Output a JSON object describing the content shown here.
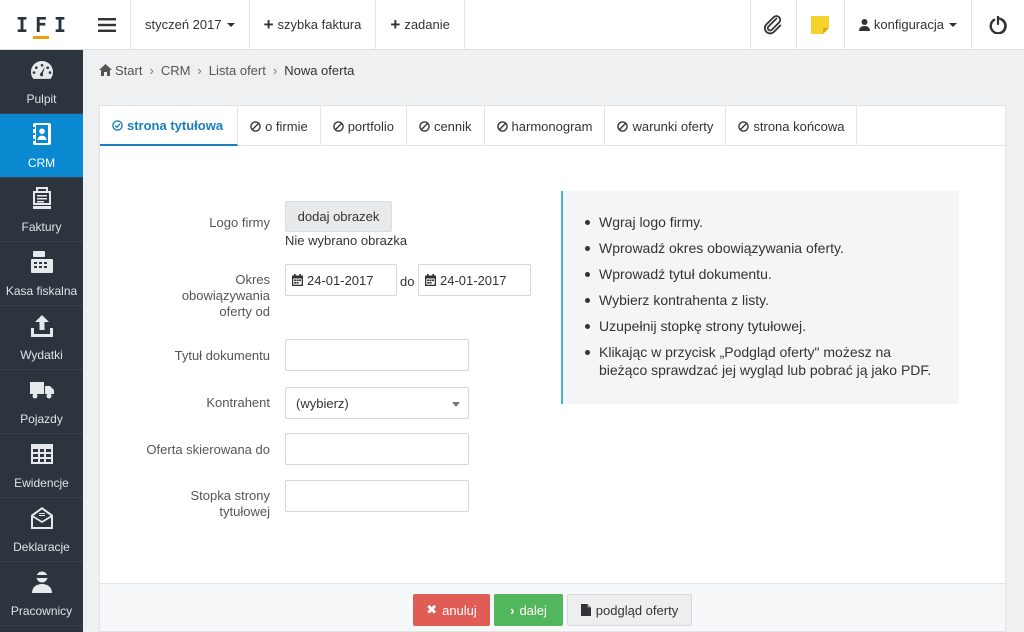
{
  "app": {
    "logo": "IFI"
  },
  "sidebar": {
    "items": [
      {
        "label": "Pulpit",
        "icon": "gauge-icon",
        "active": false
      },
      {
        "label": "CRM",
        "icon": "address-book-icon",
        "active": true
      },
      {
        "label": "Faktury",
        "icon": "invoice-icon",
        "active": false
      },
      {
        "label": "Kasa fiskalna",
        "icon": "cash-register-icon",
        "active": false
      },
      {
        "label": "Wydatki",
        "icon": "upload-icon",
        "active": false
      },
      {
        "label": "Pojazdy",
        "icon": "truck-icon",
        "active": false
      },
      {
        "label": "Ewidencje",
        "icon": "table-icon",
        "active": false
      },
      {
        "label": "Deklaracje",
        "icon": "envelope-icon",
        "active": false
      },
      {
        "label": "Pracownicy",
        "icon": "user-icon",
        "active": false
      }
    ]
  },
  "topbar": {
    "period": "styczeń 2017",
    "quick_invoice": "szybka faktura",
    "task": "zadanie",
    "config": "konfiguracja",
    "note_color": "#f7d42b"
  },
  "breadcrumb": {
    "items": [
      "Start",
      "CRM",
      "Lista ofert"
    ],
    "current": "Nowa oferta"
  },
  "tabs": [
    {
      "label": "strona tytułowa",
      "active": true
    },
    {
      "label": "o firmie",
      "active": false
    },
    {
      "label": "portfolio",
      "active": false
    },
    {
      "label": "cennik",
      "active": false
    },
    {
      "label": "harmonogram",
      "active": false
    },
    {
      "label": "warunki oferty",
      "active": false
    },
    {
      "label": "strona końcowa",
      "active": false
    }
  ],
  "form": {
    "logo_label": "Logo firmy",
    "logo_button": "dodaj obrazek",
    "logo_status": "Nie wybrano obrazka",
    "period_label_1": "Okres",
    "period_label_2": "obowiązywania",
    "period_label_3": "oferty od",
    "date_from": "24-01-2017",
    "date_sep": "do",
    "date_to": "24-01-2017",
    "title_label": "Tytuł dokumentu",
    "title_value": "",
    "contractor_label": "Kontrahent",
    "contractor_value": "(wybierz)",
    "addressed_label": "Oferta skierowana do",
    "addressed_value": "",
    "footer_label_1": "Stopka strony",
    "footer_label_2": "tytułowej",
    "footer_value": ""
  },
  "info": {
    "items": [
      "Wgraj logo firmy.",
      "Wprowadź okres obowiązywania oferty.",
      "Wprowadź tytuł dokumentu.",
      "Wybierz kontrahenta z listy.",
      "Uzupełnij stopkę strony tytułowej.",
      "Klikając w przycisk „Podgląd oferty\" możesz na bieżąco sprawdzać jej wygląd lub pobrać ją jako PDF."
    ]
  },
  "actions": {
    "cancel": "anuluj",
    "next": "dalej",
    "preview": "podgląd oferty",
    "cancel_color": "#e05d55",
    "next_color": "#52b65d"
  }
}
